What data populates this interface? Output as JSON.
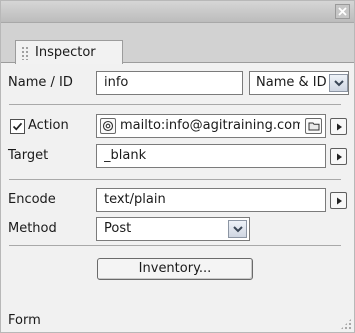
{
  "panel": {
    "tab_label": "Inspector",
    "footer_label": "Form"
  },
  "fields": {
    "name_id_label": "Name / ID",
    "name_id_value": "info",
    "name_mode_value": "Name & ID",
    "action_label": "Action",
    "action_checked": true,
    "action_value": "mailto:info@agitraining.com",
    "target_label": "Target",
    "target_value": "_blank",
    "encode_label": "Encode",
    "encode_value": "text/plain",
    "method_label": "Method",
    "method_value": "Post"
  },
  "buttons": {
    "inventory_label": "Inventory..."
  },
  "icons": {
    "close": "close-icon",
    "checkbox": "checkmark-icon",
    "email": "at-sign-icon",
    "folder": "folder-icon",
    "arrow": "triangle-right-icon",
    "dropdown": "chevron-down-icon"
  }
}
